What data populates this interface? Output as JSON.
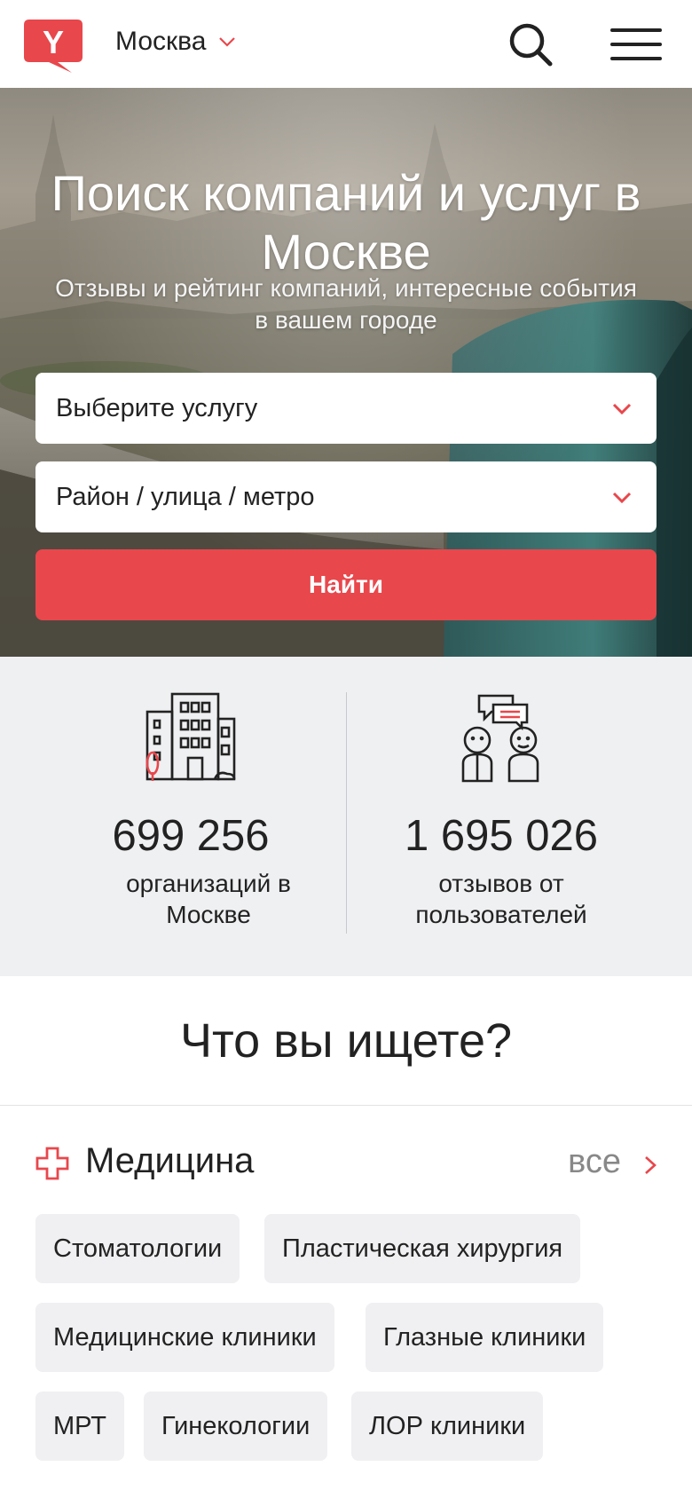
{
  "header": {
    "city": "Москва",
    "logo_letter": "Y",
    "brand_color": "#e8474c",
    "icons": {
      "search": "search-icon",
      "menu": "hamburger-menu-icon",
      "city_dropdown": "chevron-down-icon"
    }
  },
  "hero": {
    "title": "Поиск компаний и услуг в Москве",
    "subtitle": "Отзывы и рейтинг компаний, интересные события в вашем городе",
    "service_select": "Выберите услугу",
    "location_select": "Район / улица / метро",
    "find_button": "Найти"
  },
  "stats": {
    "organizations": {
      "number": "699 256",
      "label": "организаций в Москве",
      "icon": "building-icon"
    },
    "reviews": {
      "number": "1 695 026",
      "label": "отзывов от пользователей",
      "icon": "people-chat-icon"
    }
  },
  "what_heading": "Что вы ищете?",
  "category": {
    "title": "Медицина",
    "icon": "medical-cross-icon",
    "all_link": "все",
    "tags": [
      "Стоматологии",
      "Пластическая хирургия",
      "Медицинские клиники",
      "Глазные клиники",
      "МРТ",
      "Гинекологии",
      "ЛОР клиники"
    ]
  }
}
